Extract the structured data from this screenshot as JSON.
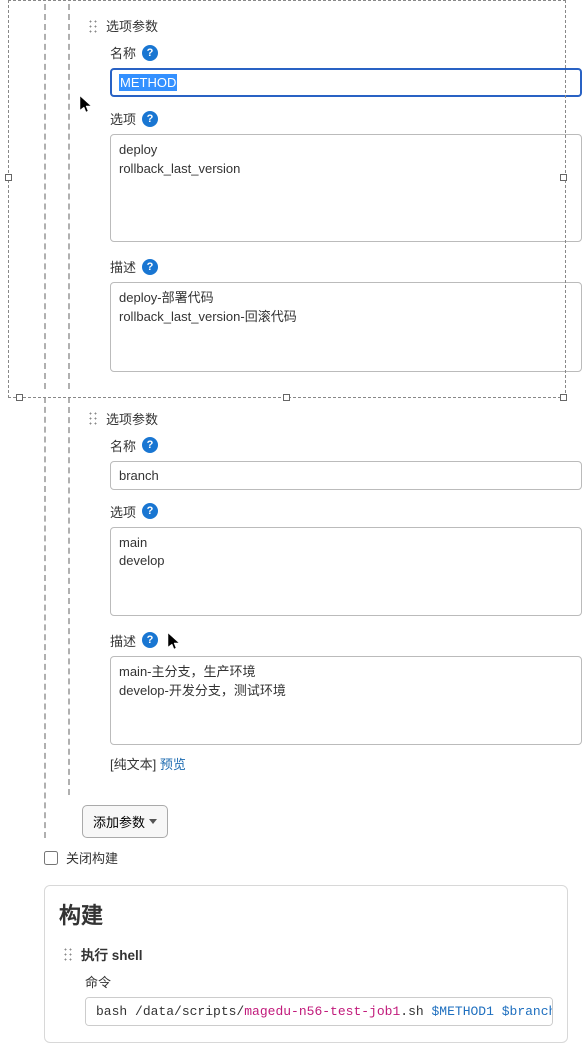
{
  "param1": {
    "section_title": "选项参数",
    "name_label": "名称",
    "name_value": "METHOD",
    "options_label": "选项",
    "options_value": "deploy\nrollback_last_version",
    "desc_label": "描述",
    "desc_value": "deploy-部署代码\nrollback_last_version-回滚代码"
  },
  "param2": {
    "section_title": "选项参数",
    "name_label": "名称",
    "name_value": "branch",
    "options_label": "选项",
    "options_value": "main\ndevelop",
    "desc_label": "描述",
    "desc_value": "main-主分支，生产环境\ndevelop-开发分支，测试环境",
    "preview_plain": "[纯文本] ",
    "preview_link": "预览"
  },
  "add_param_label": "添加参数",
  "close_build_label": "关闭构建",
  "build": {
    "title": "构建",
    "shell_title": "执行 shell",
    "command_label": "命令",
    "code_bash": "bash ",
    "code_path": "/data/scripts/",
    "code_file": "magedu-n56-test-job1",
    "code_ext": ".sh ",
    "code_var1": "$METHOD1",
    "code_sp": " ",
    "code_var2": "$branch"
  },
  "help_glyph": "?"
}
